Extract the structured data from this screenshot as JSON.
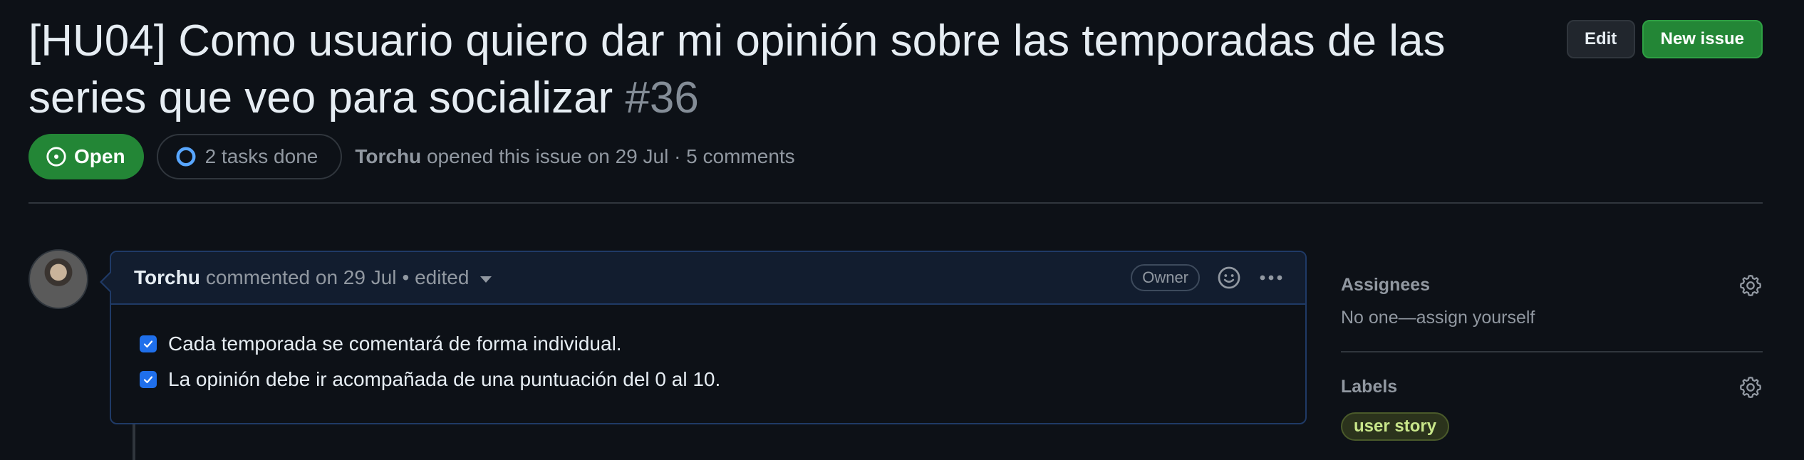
{
  "issue": {
    "title": "[HU04] Como usuario quiero dar mi opinión sobre las temporadas de las series que veo para socializar",
    "number": "#36",
    "state": "Open",
    "tasks": "2 tasks done",
    "author": "Torchu",
    "meta": "opened this issue on 29 Jul · 5 comments"
  },
  "actions": {
    "edit": "Edit",
    "new_issue": "New issue"
  },
  "comment": {
    "author": "Torchu",
    "meta": "commented on 29 Jul",
    "edited": "• edited",
    "role": "Owner",
    "tasks": [
      "Cada temporada se comentará de forma individual.",
      "La opinión debe ir acompañada de una puntuación del 0 al 10."
    ]
  },
  "sidebar": {
    "assignees_title": "Assignees",
    "assignees_value": "No one—assign yourself",
    "labels_title": "Labels",
    "label": "user story"
  },
  "icons": [
    "issue-opened-icon",
    "progress-circle-icon",
    "caret-down-icon",
    "smiley-icon",
    "kebab-icon",
    "gear-icon",
    "check-icon"
  ],
  "colors": {
    "open_green": "#238636",
    "label_bg": "#2b331c",
    "label_text": "#c8e68a",
    "accent_blue": "#1f6feb"
  }
}
